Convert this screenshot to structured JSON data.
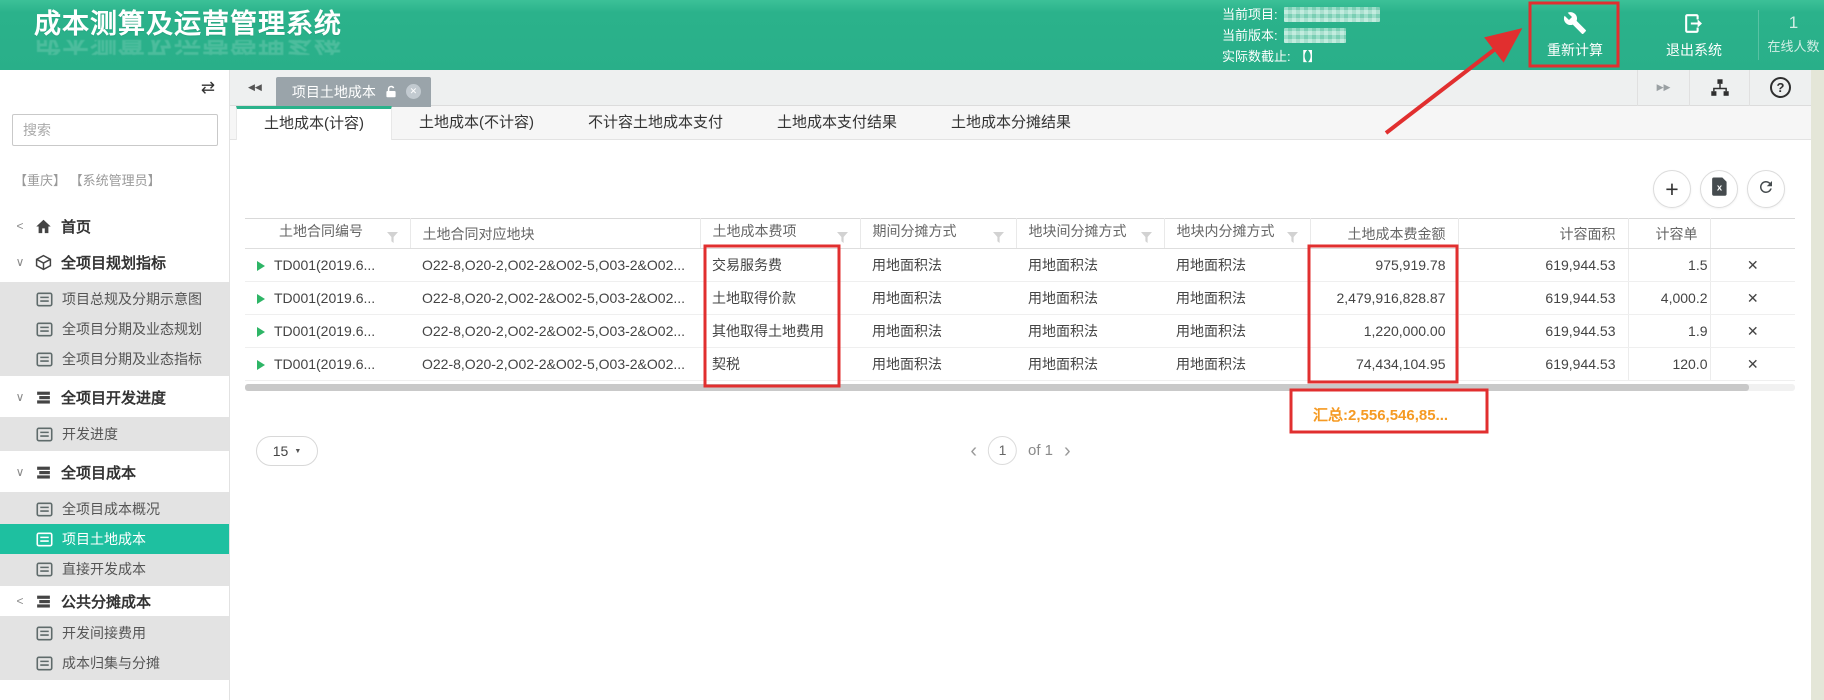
{
  "colors": {
    "header_green": "#2bb28b",
    "selected_teal": "#1ec0a0",
    "annotation_red": "#e12f2f",
    "summary_orange": "#f59a23",
    "delete_blue": "#2f7cd6",
    "row_arrow_green": "#2eb566"
  },
  "header": {
    "title": "成本测算及运营管理系统",
    "current_project_label": "当前项目:",
    "current_version_label": "当前版本:",
    "cutoff_label": "实际数截止:",
    "cutoff_value": "【】",
    "recalculate": "重新计算",
    "logout": "退出系统",
    "online_count": "1",
    "online_label": "在线人数"
  },
  "sidebar": {
    "search_placeholder": "搜索",
    "user_info": "【重庆】 【系统管理员】",
    "items": [
      {
        "label": "首页"
      },
      {
        "label": "全项目规划指标"
      },
      {
        "label": "项目总规及分期示意图"
      },
      {
        "label": "全项目分期及业态规划"
      },
      {
        "label": "全项目分期及业态指标"
      },
      {
        "label": "全项目开发进度"
      },
      {
        "label": "开发进度"
      },
      {
        "label": "全项目成本"
      },
      {
        "label": "全项目成本概况"
      },
      {
        "label": "项目土地成本"
      },
      {
        "label": "直接开发成本"
      },
      {
        "label": "公共分摊成本"
      },
      {
        "label": "开发间接费用"
      },
      {
        "label": "成本归集与分摊"
      }
    ]
  },
  "window_tab": {
    "label": "项目土地成本"
  },
  "tabs": [
    {
      "label": "土地成本(计容)"
    },
    {
      "label": "土地成本(不计容)"
    },
    {
      "label": "不计容土地成本支付"
    },
    {
      "label": "土地成本支付结果"
    },
    {
      "label": "土地成本分摊结果"
    }
  ],
  "table": {
    "columns": [
      "土地合同编号",
      "土地合同对应地块",
      "土地成本费项",
      "期间分摊方式",
      "地块间分摊方式",
      "地块内分摊方式",
      "土地成本费金额",
      "计容面积",
      "计容单"
    ],
    "rows": [
      {
        "contract": "TD001(2019.6...",
        "parcel": "O22-8,O20-2,O02-2&O02-5,O03-2&O02...",
        "item": "交易服务费",
        "period": "用地面积法",
        "between": "用地面积法",
        "within": "用地面积法",
        "amount": "975,919.78",
        "area": "619,944.53",
        "unit": "1.5"
      },
      {
        "contract": "TD001(2019.6...",
        "parcel": "O22-8,O20-2,O02-2&O02-5,O03-2&O02...",
        "item": "土地取得价款",
        "period": "用地面积法",
        "between": "用地面积法",
        "within": "用地面积法",
        "amount": "2,479,916,828.87",
        "area": "619,944.53",
        "unit": "4,000.2"
      },
      {
        "contract": "TD001(2019.6...",
        "parcel": "O22-8,O20-2,O02-2&O02-5,O03-2&O02...",
        "item": "其他取得土地费用",
        "period": "用地面积法",
        "between": "用地面积法",
        "within": "用地面积法",
        "amount": "1,220,000.00",
        "area": "619,944.53",
        "unit": "1.9"
      },
      {
        "contract": "TD001(2019.6...",
        "parcel": "O22-8,O20-2,O02-2&O02-5,O03-2&O02...",
        "item": "契税",
        "period": "用地面积法",
        "between": "用地面积法",
        "within": "用地面积法",
        "amount": "74,434,104.95",
        "area": "619,944.53",
        "unit": "120.0"
      }
    ],
    "summary": "汇总:2,556,546,85..."
  },
  "pagination": {
    "page_size": "15",
    "current_page": "1",
    "of_label": "of 1"
  },
  "icons": {
    "collapse_sidebar": "⇄",
    "tabs_scroll_left": "◀◀",
    "tabs_scroll_right": "▶▶",
    "help": "?",
    "add": "+",
    "delete": "✕",
    "close": "✕",
    "pager_prev": "‹",
    "pager_next": "›",
    "dropdown_caret": "▼",
    "chevron_expanded": "∨",
    "chevron_collapsed": "<"
  }
}
